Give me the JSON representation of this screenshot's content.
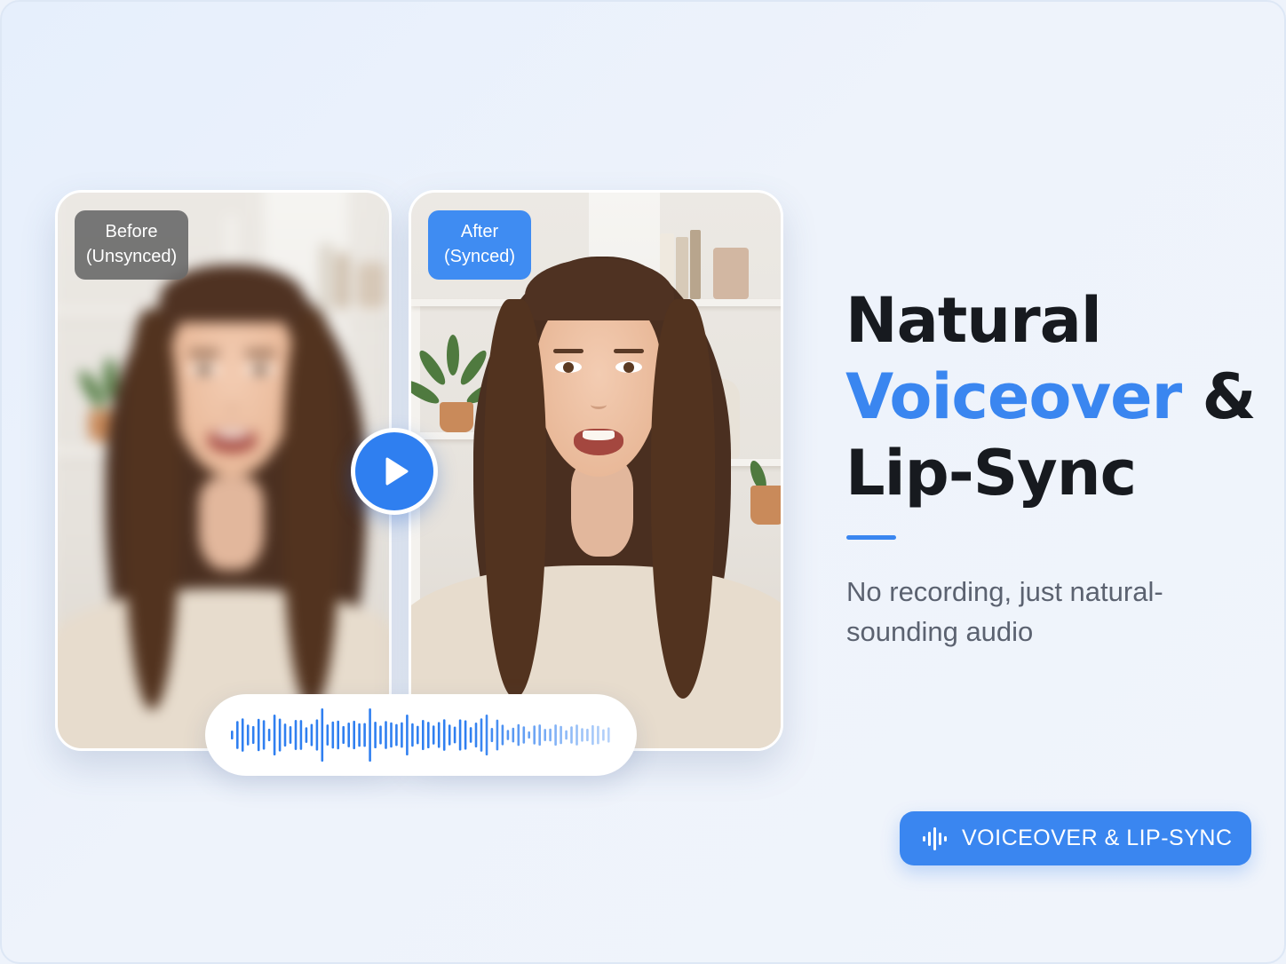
{
  "comparison": {
    "before_label": "Before\n(Unsynced)",
    "after_label": "After\n(Synced)"
  },
  "player": {
    "play_icon": "play-icon",
    "waveform_icon": "audio-waveform"
  },
  "headline": {
    "line1": "Natural",
    "accent": "Voiceover",
    "amp": " &",
    "line3": "Lip-Sync"
  },
  "subtitle": "No recording, just natural-sounding audio",
  "tag": {
    "icon": "audio-wave-icon",
    "label": "VOICEOVER & LIP-SYNC"
  },
  "colors": {
    "accent": "#3a86f0",
    "background": "#eef3fb",
    "headline": "#171a1f",
    "subtitle": "#5b6270",
    "before_badge": "#696969"
  }
}
